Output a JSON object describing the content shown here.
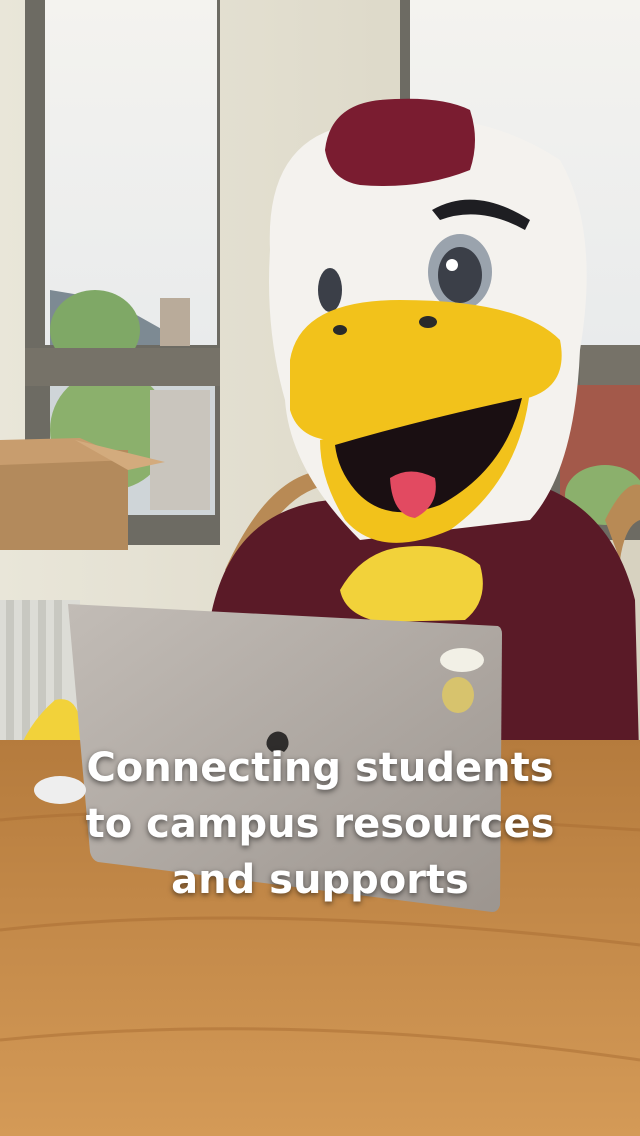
{
  "caption": {
    "lines": [
      "Connecting students",
      "to campus resources",
      "and supports"
    ]
  },
  "colors": {
    "mascot_maroon": "#6b1e2e",
    "beak_yellow": "#f2c21b",
    "sweater_maroon": "#5a1a27",
    "table_wood": "#c58a4a",
    "laptop_silver": "#b9b2ad"
  }
}
